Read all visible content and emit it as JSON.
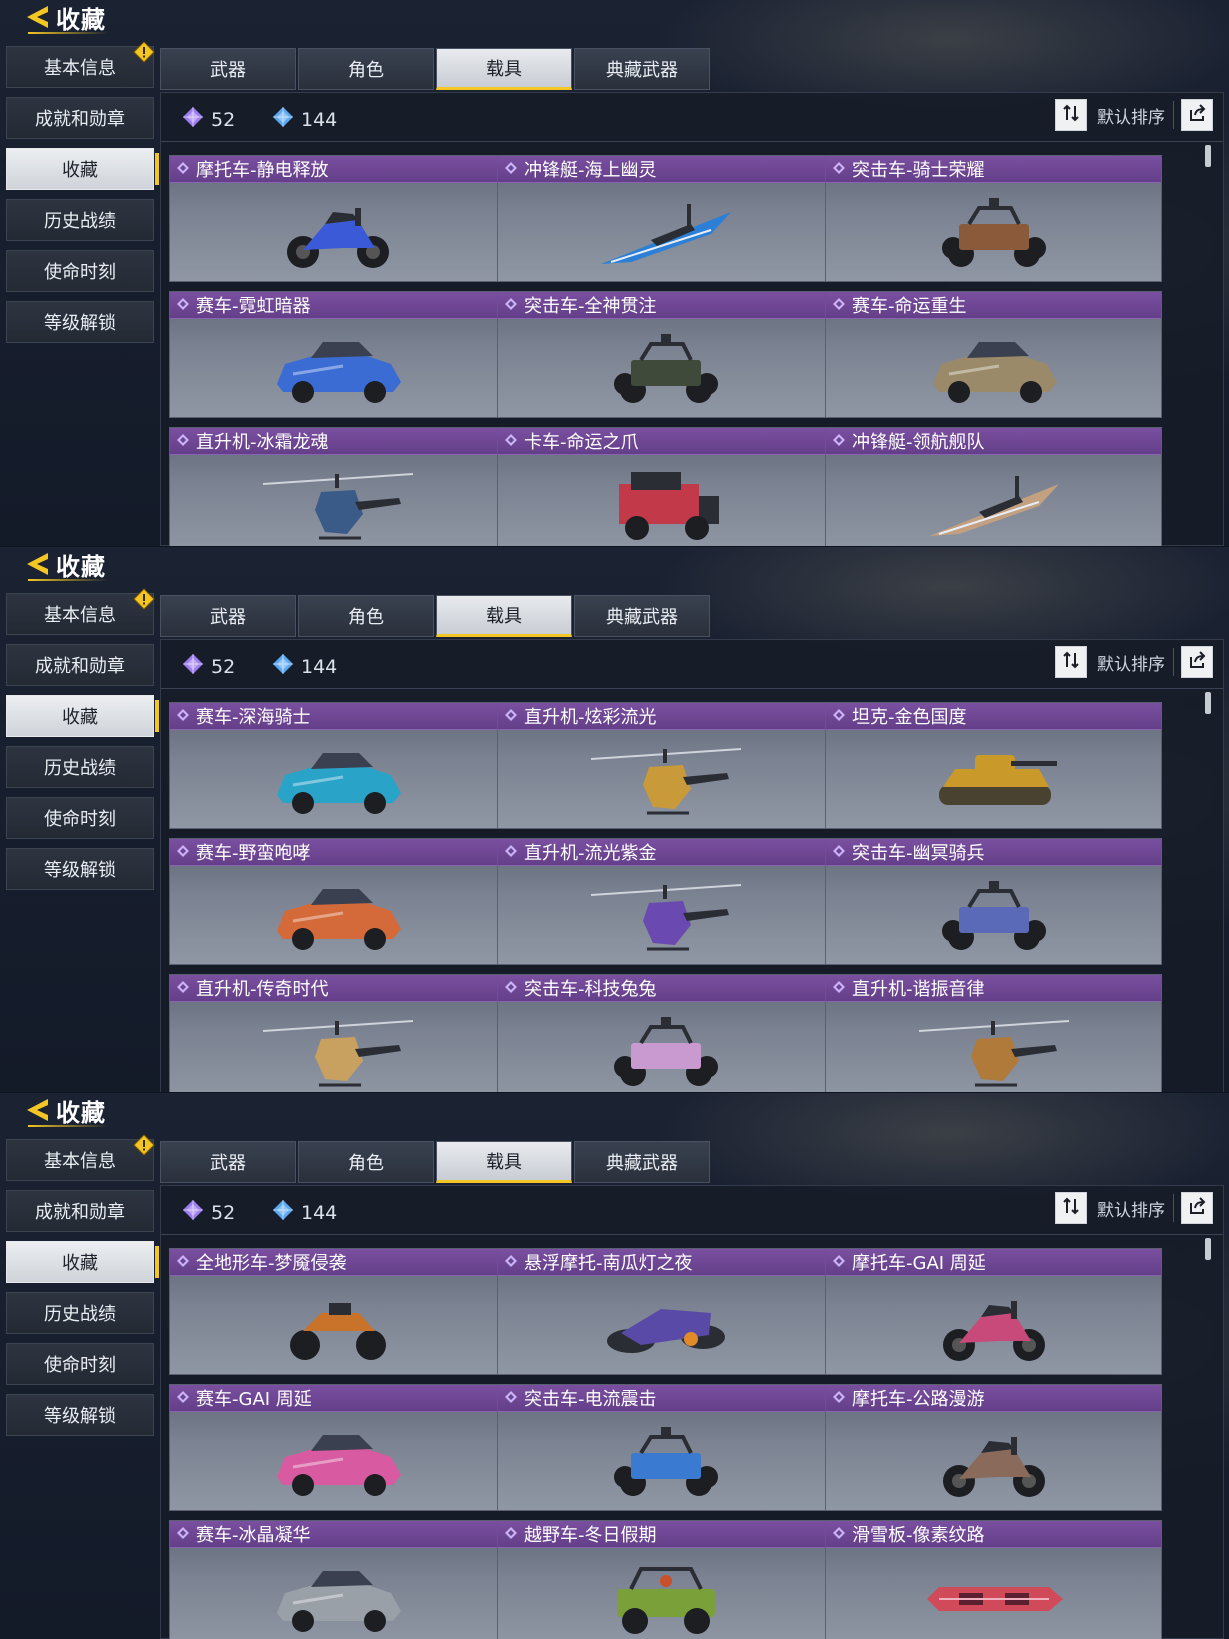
{
  "header": {
    "title": "收藏"
  },
  "sidebar": {
    "items": [
      {
        "label": "基本信息",
        "alert": true
      },
      {
        "label": "成就和勋章"
      },
      {
        "label": "收藏",
        "active": true
      },
      {
        "label": "历史战绩"
      },
      {
        "label": "使命时刻"
      },
      {
        "label": "等级解锁"
      }
    ]
  },
  "tabs": [
    {
      "label": "武器"
    },
    {
      "label": "角色"
    },
    {
      "label": "载具",
      "active": true
    },
    {
      "label": "典藏武器"
    }
  ],
  "currency": {
    "purple_count": "52",
    "blue_count": "144"
  },
  "sort": {
    "label": "默认排序"
  },
  "colors": {
    "accent": "#f3c623",
    "card_title": "#6b4393",
    "purple_gem": "#9d7cf0",
    "blue_gem": "#5aa7f2"
  },
  "panels": [
    {
      "cards": [
        {
          "name": "摩托车-静电释放",
          "type": "motorcycle",
          "color": "#3a5ad8"
        },
        {
          "name": "冲锋艇-海上幽灵",
          "type": "boat",
          "color": "#2b7fd6"
        },
        {
          "name": "突击车-骑士荣耀",
          "type": "buggy",
          "color": "#8a5a3a"
        },
        {
          "name": "赛车-霓虹暗器",
          "type": "car",
          "color": "#3a6cd4"
        },
        {
          "name": "突击车-全神贯注",
          "type": "buggy",
          "color": "#3f4a3a"
        },
        {
          "name": "赛车-命运重生",
          "type": "car",
          "color": "#9a8a6a"
        },
        {
          "name": "直升机-冰霜龙魂",
          "type": "helicopter",
          "color": "#3a5a88"
        },
        {
          "name": "卡车-命运之爪",
          "type": "truck",
          "color": "#c23a4a"
        },
        {
          "name": "冲锋艇-领航舰队",
          "type": "boat",
          "color": "#c2a080"
        }
      ]
    },
    {
      "cards": [
        {
          "name": "赛车-深海骑士",
          "type": "car",
          "color": "#2aa3c8"
        },
        {
          "name": "直升机-炫彩流光",
          "type": "helicopter",
          "color": "#c89a3a"
        },
        {
          "name": "坦克-金色国度",
          "type": "tank",
          "color": "#c99a2a"
        },
        {
          "name": "赛车-野蛮咆哮",
          "type": "car",
          "color": "#d46a3a"
        },
        {
          "name": "直升机-流光紫金",
          "type": "helicopter",
          "color": "#6a4ab0"
        },
        {
          "name": "突击车-幽冥骑兵",
          "type": "buggy",
          "color": "#5a6ab8"
        },
        {
          "name": "直升机-传奇时代",
          "type": "helicopter",
          "color": "#c8a060"
        },
        {
          "name": "突击车-科技兔兔",
          "type": "buggy",
          "color": "#c89ad0"
        },
        {
          "name": "直升机-谐振音律",
          "type": "helicopter",
          "color": "#b07a3a"
        }
      ]
    },
    {
      "cards": [
        {
          "name": "全地形车-梦魇侵袭",
          "type": "atv",
          "color": "#c8722a"
        },
        {
          "name": "悬浮摩托-南瓜灯之夜",
          "type": "hover",
          "color": "#5a4aa8"
        },
        {
          "name": "摩托车-GAI 周延",
          "type": "motorcycle",
          "color": "#c84a7a"
        },
        {
          "name": "赛车-GAI 周延",
          "type": "car",
          "color": "#d85aa0"
        },
        {
          "name": "突击车-电流震击",
          "type": "buggy",
          "color": "#3a7ad0"
        },
        {
          "name": "摩托车-公路漫游",
          "type": "motorcycle",
          "color": "#8a6a5a"
        },
        {
          "name": "赛车-冰晶凝华",
          "type": "car",
          "color": "#9aa0a8"
        },
        {
          "name": "越野车-冬日假期",
          "type": "jeep",
          "color": "#7aa03a"
        },
        {
          "name": "滑雪板-像素纹路",
          "type": "board",
          "color": "#d04a5a"
        }
      ]
    }
  ]
}
